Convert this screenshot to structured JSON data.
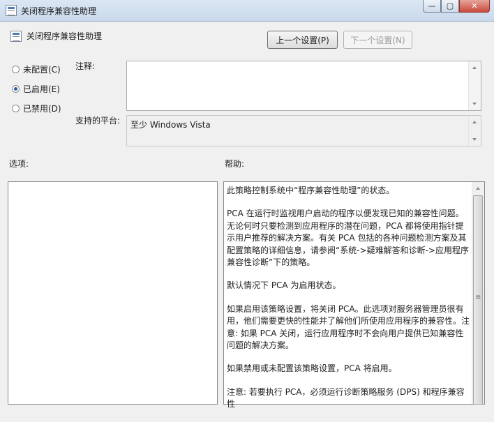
{
  "window": {
    "title": "关闭程序兼容性助理",
    "url_blur": "http://...",
    "buttons": {
      "minimize": "—",
      "maximize": "▢",
      "close": "✕"
    }
  },
  "header": {
    "title": "关闭程序兼容性助理",
    "prev_button": "上一个设置(P)",
    "next_button": "下一个设置(N)"
  },
  "radios": [
    {
      "label": "未配置(C)",
      "checked": false
    },
    {
      "label": "已启用(E)",
      "checked": true
    },
    {
      "label": "已禁用(D)",
      "checked": false
    }
  ],
  "labels": {
    "comment": "注释:",
    "platform": "支持的平台:",
    "options": "选项:",
    "help": "帮助:"
  },
  "comment_value": "",
  "platform_value": "至少 Windows Vista",
  "help_paragraphs": [
    "此策略控制系统中“程序兼容性助理”的状态。",
    "PCA 在运行时监视用户启动的程序以便发现已知的兼容性问题。无论何时只要检测到应用程序的潜在问题，PCA 都将使用指针提示用户推荐的解决方案。有关 PCA 包括的各种问题检测方案及其配置策略的详细信息，请参阅“系统->疑难解答和诊断->应用程序兼容性诊断”下的策略。",
    "默认情况下 PCA 为启用状态。",
    "如果启用该策略设置，将关闭 PCA。此选项对服务器管理员很有用，他们需要更快的性能并了解他们所使用应用程序的兼容性。注意: 如果 PCA 关闭，运行应用程序时不会向用户提供已知兼容性问题的解决方案。",
    "如果禁用或未配置该策略设置，PCA 将启用。",
    "注意: 若要执行 PCA，必须运行诊断策略服务 (DPS) 和程序兼容性"
  ],
  "icons": {
    "app": "policy-window-icon",
    "header": "policy-setting-icon"
  }
}
